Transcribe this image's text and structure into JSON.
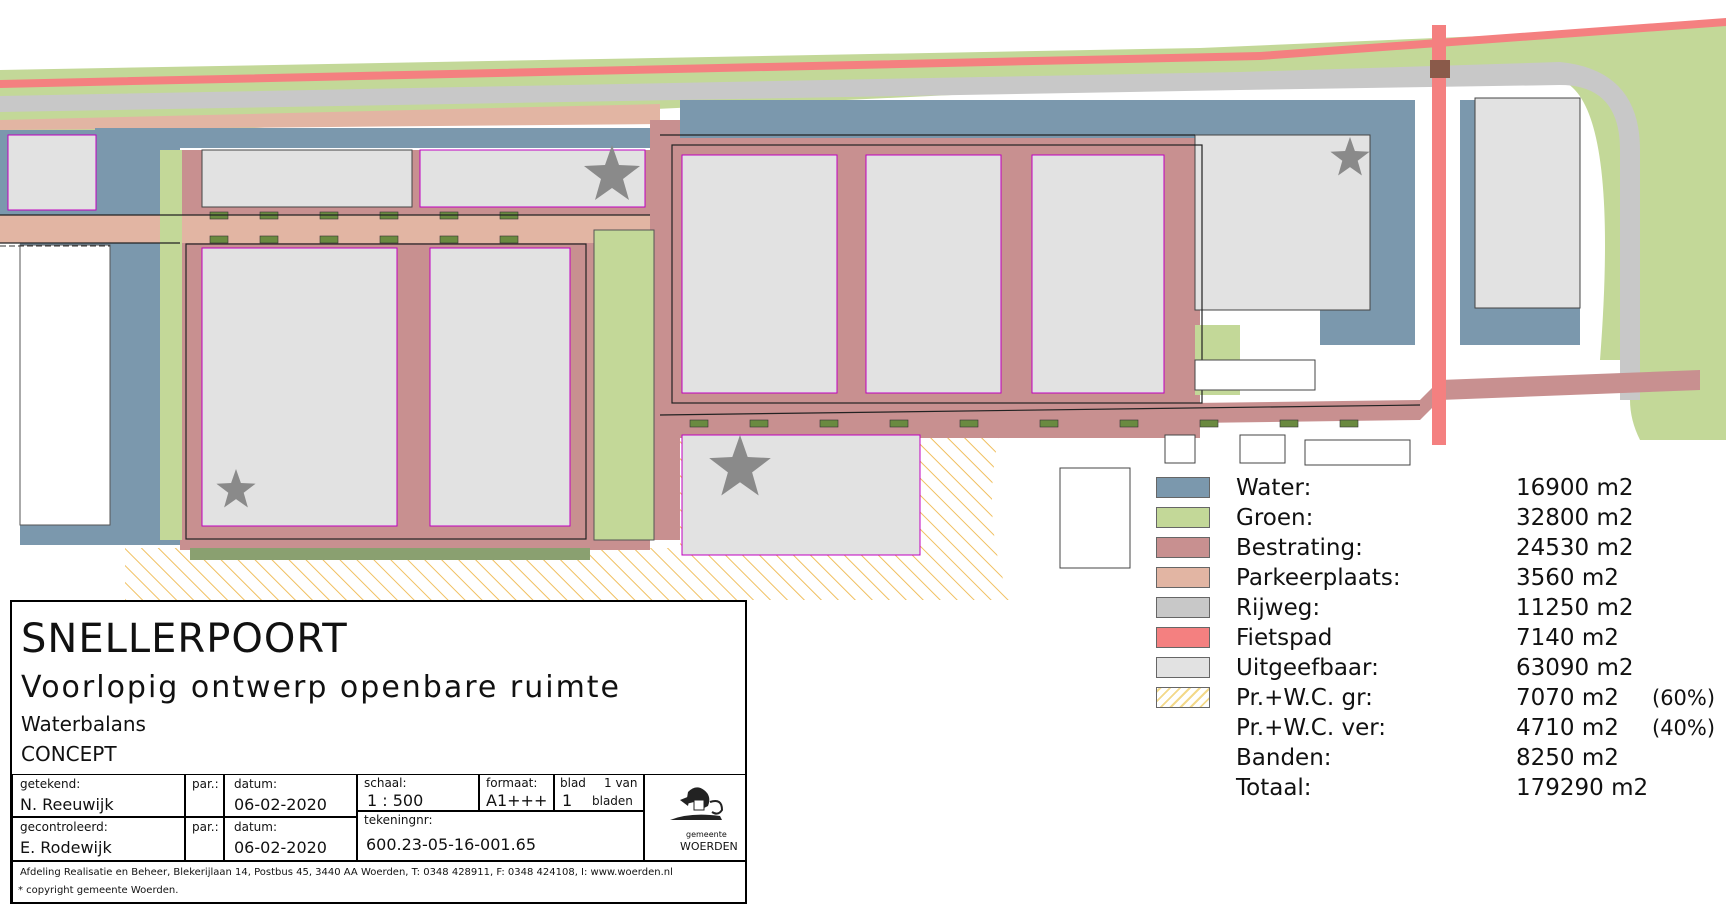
{
  "legend": [
    {
      "label": "Water:",
      "value": "16900 m2",
      "pct": "",
      "color": "#7b98ad",
      "hatch": false
    },
    {
      "label": "Groen:",
      "value": "32800 m2",
      "pct": "",
      "color": "#c3d898",
      "hatch": false
    },
    {
      "label": "Bestrating:",
      "value": "24530 m2",
      "pct": "",
      "color": "#c89090",
      "hatch": false
    },
    {
      "label": "Parkeerplaats:",
      "value": "3560 m2",
      "pct": "",
      "color": "#e2b5a3",
      "hatch": false
    },
    {
      "label": "Rijweg:",
      "value": "11250 m2",
      "pct": "",
      "color": "#c8c8c8",
      "hatch": false
    },
    {
      "label": "Fietspad",
      "value": "7140 m2",
      "pct": "",
      "color": "#f48080",
      "hatch": false
    },
    {
      "label": "Uitgeefbaar:",
      "value": "63090 m2",
      "pct": "",
      "color": "#e2e2e2",
      "hatch": false
    },
    {
      "label": "Pr.+W.C. gr:",
      "value": "7070 m2",
      "pct": "(60%)",
      "color": "#f3d98a",
      "hatch": true
    },
    {
      "label": "Pr.+W.C. ver:",
      "value": "4710 m2",
      "pct": "(40%)",
      "color": "",
      "hatch": false
    },
    {
      "label": "Banden:",
      "value": "8250 m2",
      "pct": "",
      "color": "",
      "hatch": false
    },
    {
      "label": "Totaal:",
      "value": "179290 m2",
      "pct": "",
      "color": "",
      "hatch": false
    }
  ],
  "titleblock": {
    "project": "SNELLERPOORT",
    "subtitle": "Voorlopig ontwerp openbare ruimte",
    "sheet_name": "Waterbalans",
    "status": "CONCEPT",
    "getekend_label": "getekend:",
    "getekend_name": "N. Reeuwijk",
    "par_label": "par.:",
    "datum_label": "datum:",
    "datum_1": "06-02-2020",
    "gecontroleerd_label": "gecontroleerd:",
    "gecontroleerd_name": "E. Rodewijk",
    "datum_2": "06-02-2020",
    "schaal_label": "schaal:",
    "schaal_value": "1 : 500",
    "formaat_label": "formaat:",
    "formaat_value": "A1+++",
    "blad_label": "blad",
    "blad_value": "1",
    "van_label": "1 van",
    "bladen_label": "bladen",
    "tekeningnr_label": "tekeningnr:",
    "tekeningnr_value": "600.23-05-16-001.65",
    "logo_small": "gemeente",
    "logo_name": "WOERDEN",
    "address": "Afdeling Realisatie en Beheer, Blekerijlaan 14, Postbus 45, 3440 AA Woerden, T: 0348 428911, F: 0348 424108, I: www.woerden.nl",
    "copyright": "* copyright gemeente Woerden."
  }
}
